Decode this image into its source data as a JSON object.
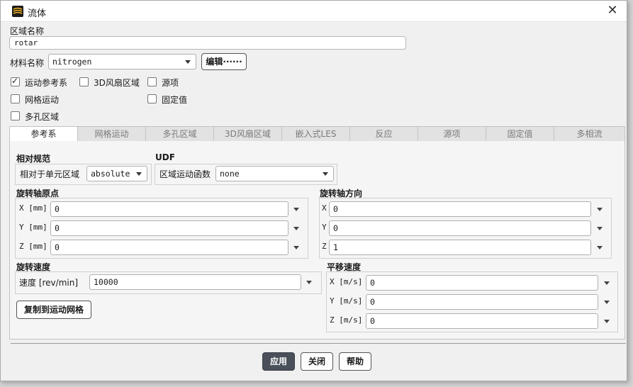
{
  "dialog": {
    "title": "流体",
    "zone_name_label": "区域名称",
    "zone_name_value": "rotar",
    "material_label": "材料名称",
    "material_value": "nitrogen",
    "edit_label": "编辑······",
    "checkboxes": [
      {
        "label": "运动参考系",
        "checked": true
      },
      {
        "label": "3D风扇区域",
        "checked": false
      },
      {
        "label": "源项",
        "checked": false
      },
      {
        "label": "网格运动",
        "checked": false
      },
      {
        "label": "固定值",
        "checked": false
      },
      {
        "label": "多孔区域",
        "checked": false
      }
    ],
    "tabs": [
      "参考系",
      "网格运动",
      "多孔区域",
      "3D风扇区域",
      "嵌入式LES",
      "反应",
      "源项",
      "固定值",
      "多相流"
    ],
    "relative_spec": {
      "title": "相对规范",
      "label": "相对于单元区域",
      "value": "absolute"
    },
    "udf": {
      "title": "UDF",
      "label": "区域运动函数",
      "value": "none"
    },
    "axis_origin": {
      "title": "旋转轴原点",
      "rows": [
        {
          "label": "X [mm]",
          "value": "0"
        },
        {
          "label": "Y [mm]",
          "value": "0"
        },
        {
          "label": "Z [mm]",
          "value": "0"
        }
      ]
    },
    "axis_direction": {
      "title": "旋转轴方向",
      "rows": [
        {
          "label": "X",
          "value": "0"
        },
        {
          "label": "Y",
          "value": "0"
        },
        {
          "label": "Z",
          "value": "1"
        }
      ]
    },
    "rotation_speed": {
      "title": "旋转速度",
      "label": "速度 [rev/min]",
      "value": "10000"
    },
    "copy_button": "复制到运动网格",
    "translation_velocity": {
      "title": "平移速度",
      "rows": [
        {
          "label": "X [m/s]",
          "value": "0"
        },
        {
          "label": "Y [m/s]",
          "value": "0"
        },
        {
          "label": "Z [m/s]",
          "value": "0"
        }
      ]
    },
    "buttons": {
      "apply": "应用",
      "close": "关闭",
      "help": "帮助"
    }
  }
}
